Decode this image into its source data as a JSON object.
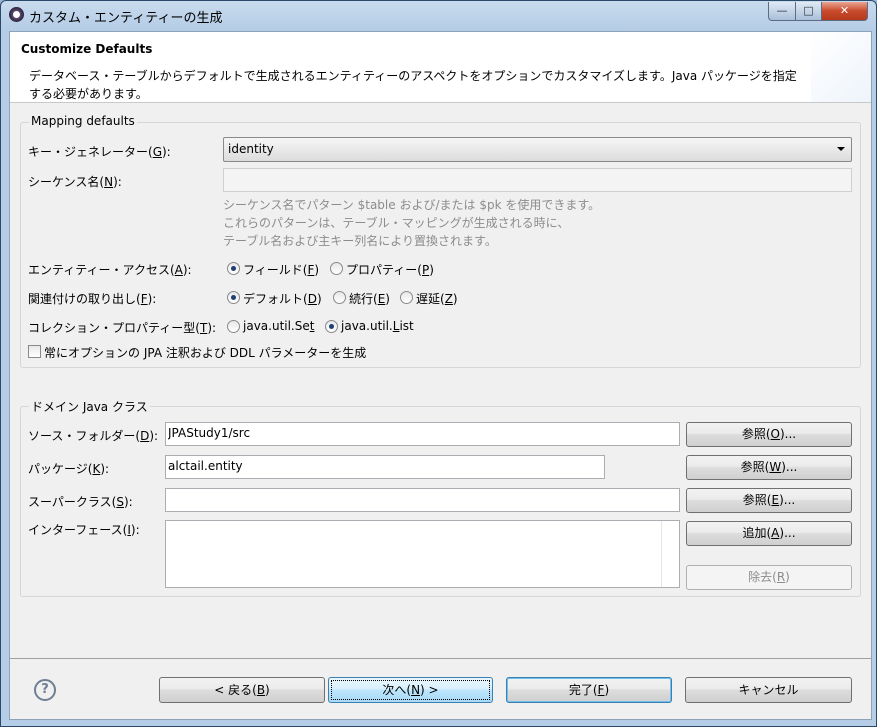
{
  "window": {
    "title": "カスタム・エンティティーの生成",
    "min_glyph": "—",
    "max_glyph": "□",
    "close_glyph": "✕"
  },
  "header": {
    "title": "Customize Defaults",
    "description": "データベース・テーブルからデフォルトで生成されるエンティティーのアスペクトをオプションでカスタマイズします。Java パッケージを指定する必要があります。"
  },
  "mapping": {
    "group_label": "Mapping defaults",
    "key_generator": {
      "label_pre": "キー・ジェネレーター(",
      "mnemonic": "G",
      "label_post": "):",
      "value": "identity"
    },
    "sequence_name": {
      "label_pre": "シーケンス名(",
      "mnemonic": "N",
      "label_post": "):",
      "value": ""
    },
    "hint_lines": [
      "シーケンス名でパターン $table および/または $pk を使用できます。",
      "これらのパターンは、テーブル・マッピングが生成される時に、",
      "テーブル名および主キー列名により置換されます。"
    ],
    "entity_access": {
      "label_pre": "エンティティー・アクセス(",
      "mnemonic": "A",
      "label_post": "):",
      "options": [
        {
          "pre": "フィールド(",
          "mn": "F",
          "post": ")",
          "selected": true
        },
        {
          "pre": "プロパティー(",
          "mn": "P",
          "post": ")",
          "selected": false
        }
      ]
    },
    "fetch": {
      "label_pre": "関連付けの取り出し(",
      "mnemonic": "F",
      "label_post": "):",
      "options": [
        {
          "pre": "デフォルト(",
          "mn": "D",
          "post": ")",
          "selected": true
        },
        {
          "pre": "続行(",
          "mn": "E",
          "post": ")",
          "selected": false
        },
        {
          "pre": "遅延(",
          "mn": "Z",
          "post": ")",
          "selected": false
        }
      ]
    },
    "collection_type": {
      "label_pre": "コレクション・プロパティー型(",
      "mnemonic": "T",
      "label_post": "):",
      "options": [
        {
          "pre": "java.util.Se",
          "mn": "t",
          "post": "",
          "selected": false
        },
        {
          "pre": "java.util.",
          "mn": "L",
          "post": "ist",
          "selected": true
        }
      ]
    },
    "always_generate": {
      "label": "常にオプションの JPA 注釈および DDL パラメーターを生成",
      "checked": false
    }
  },
  "domain": {
    "group_label": "ドメイン Java クラス",
    "source_folder": {
      "label_pre": "ソース・フォルダー(",
      "mnemonic": "D",
      "label_post": "):",
      "value": "JPAStudy1/src",
      "button_pre": "参照(",
      "button_mn": "O",
      "button_post": ")..."
    },
    "package": {
      "label_pre": "パッケージ(",
      "mnemonic": "K",
      "label_post": "):",
      "value": "alctail.entity",
      "button_pre": "参照(",
      "button_mn": "W",
      "button_post": ")..."
    },
    "superclass": {
      "label_pre": "スーパークラス(",
      "mnemonic": "S",
      "label_post": "):",
      "value": "",
      "button_pre": "参照(",
      "button_mn": "E",
      "button_post": ")..."
    },
    "interfaces": {
      "label_pre": "インターフェース(",
      "mnemonic": "I",
      "label_post": "):",
      "add_pre": "追加(",
      "add_mn": "A",
      "add_post": ")...",
      "remove_pre": "除去(",
      "remove_mn": "R",
      "remove_post": ")"
    }
  },
  "footer": {
    "help_glyph": "?",
    "back": {
      "pre": "< 戻る(",
      "mn": "B",
      "post": ")"
    },
    "next": {
      "pre": "次へ(",
      "mn": "N",
      "post": ") >"
    },
    "finish": {
      "pre": "完了(",
      "mn": "F",
      "post": ")"
    },
    "cancel": {
      "label": "キャンセル"
    }
  }
}
